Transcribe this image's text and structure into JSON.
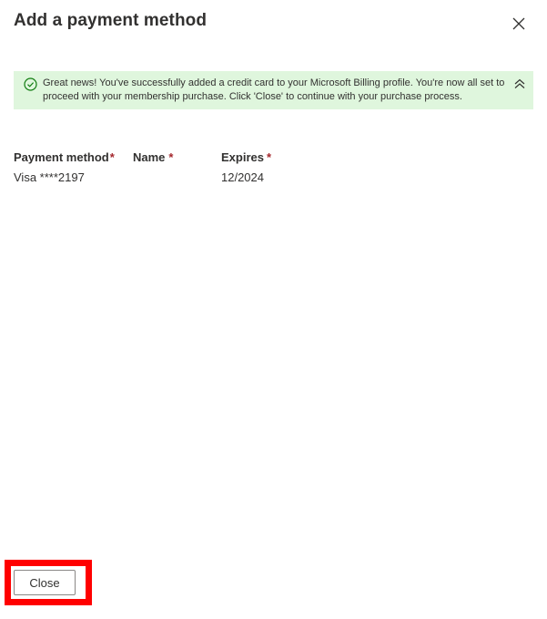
{
  "dialog": {
    "title": "Add a payment method"
  },
  "banner": {
    "message": "Great news! You've successfully added a credit card to your Microsoft Billing profile. You're now all set to proceed with your membership purchase. Click 'Close' to continue with your purchase process.",
    "status": "success",
    "icon": "checkmark-circle-icon",
    "collapse_icon": "double-chevron-up-icon",
    "background": "#dff6dd",
    "icon_color": "#107c10"
  },
  "fields": {
    "payment_method": {
      "label": "Payment method",
      "required_marker": "*",
      "value": "Visa ****2197"
    },
    "name": {
      "label": "Name",
      "required_marker": "*",
      "value": ""
    },
    "expires": {
      "label": "Expires",
      "required_marker": "*",
      "value": "12/2024"
    }
  },
  "footer": {
    "close_label": "Close",
    "highlight_color": "#ff0000"
  }
}
